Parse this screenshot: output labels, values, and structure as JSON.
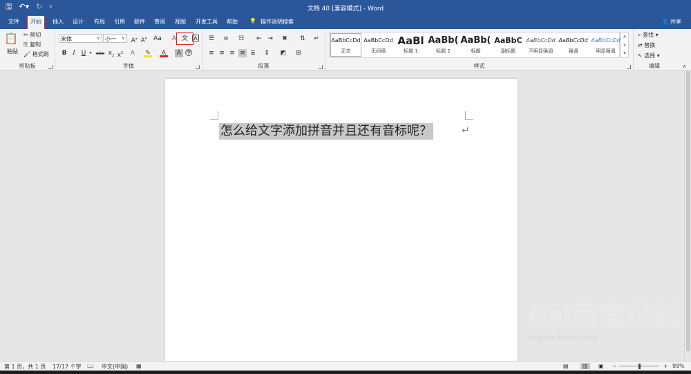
{
  "window": {
    "title": "文档 40 [兼容模式]  -  Word",
    "share": "共享"
  },
  "qat": {
    "save_icon": "save-icon",
    "undo_icon": "undo-icon",
    "redo_icon": "redo-icon",
    "customize_icon": "customize-icon"
  },
  "tabs": [
    "文件",
    "开始",
    "插入",
    "设计",
    "布局",
    "引用",
    "邮件",
    "审阅",
    "视图",
    "开发工具",
    "帮助"
  ],
  "tell_me": "操作说明搜索",
  "clipboard": {
    "paste": "粘贴",
    "cut": "剪切",
    "copy": "复制",
    "format_painter": "格式刷",
    "label": "剪贴板"
  },
  "font": {
    "name": "宋体",
    "size": "小一",
    "label": "字体",
    "change_case": "Aa",
    "phonetic": "文"
  },
  "paragraph": {
    "label": "段落"
  },
  "styles": {
    "label": "样式",
    "items": [
      {
        "preview": "AaBbCcDd",
        "name": "正文"
      },
      {
        "preview": "AaBbCcDd",
        "name": "无间隔"
      },
      {
        "preview": "AaBl",
        "name": "标题 1"
      },
      {
        "preview": "AaBb(",
        "name": "标题 2"
      },
      {
        "preview": "AaBb(",
        "name": "标题"
      },
      {
        "preview": "AaBbC",
        "name": "副标题"
      },
      {
        "preview": "AaBbCcDd",
        "name": "不明显强调"
      },
      {
        "preview": "AaBbCcDd",
        "name": "强调"
      },
      {
        "preview": "AaBbCcDd",
        "name": "明显强调"
      }
    ]
  },
  "editing": {
    "find": "查找",
    "replace": "替换",
    "select": "选择",
    "label": "编辑"
  },
  "document": {
    "text": "怎么给文字添加拼音并且还有音标呢？",
    "paragraph_mark": "↵"
  },
  "status": {
    "page": "第 1 页，共 1 页",
    "words": "17/17 个字",
    "language": "中文(中国)",
    "zoom": "99%",
    "zoom_out": "−",
    "zoom_in": "+"
  },
  "watermark": {
    "brand": "Bai百度经验",
    "url": "jingyan.baidu.com"
  },
  "colors": {
    "accent": "#2b579a",
    "highlight": "#c8c8c8",
    "annotation": "#e02020"
  }
}
